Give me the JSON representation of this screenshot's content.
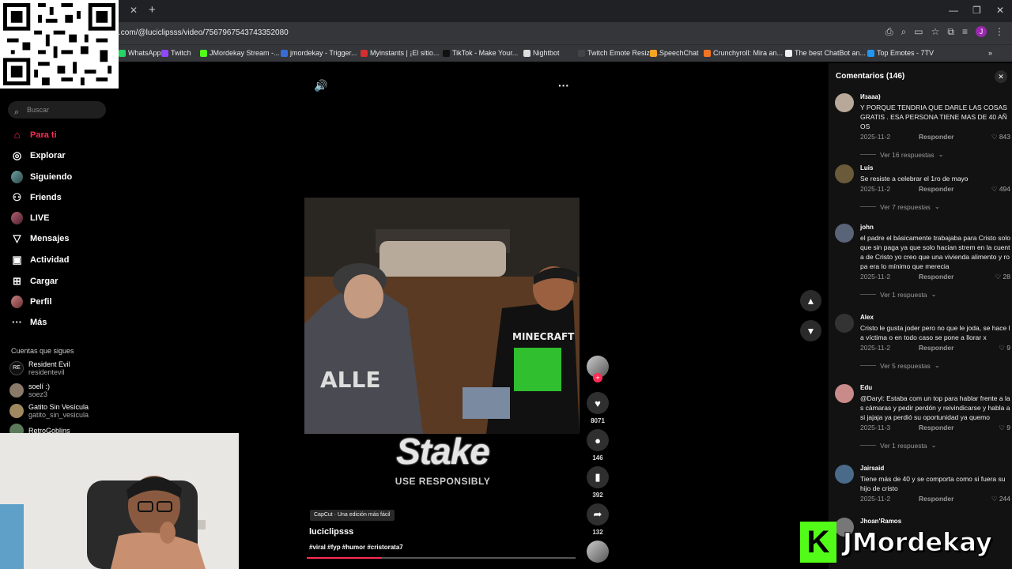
{
  "browser": {
    "url": ".com/@luciclipsss/video/7567967543743352080",
    "tab_close": "✕",
    "tab_new": "+",
    "bookmarks": [
      {
        "label": "WhatsApp",
        "color": "#25d366"
      },
      {
        "label": "Twitch",
        "color": "#9146ff"
      },
      {
        "label": "JMordekay Stream -...",
        "color": "#53fc18"
      },
      {
        "label": "jmordekay - Trigger...",
        "color": "#3b6bd6"
      },
      {
        "label": "Myinstants | ¡El sitio...",
        "color": "#d32f2f"
      },
      {
        "label": "TikTok - Make Your...",
        "color": "#111111"
      },
      {
        "label": "Nightbot",
        "color": "#dddddd"
      },
      {
        "label": "Twitch Emote Resize...",
        "color": "#444444"
      },
      {
        "label": "SpeechChat",
        "color": "#f5a623"
      },
      {
        "label": "Crunchyroll: Mira an...",
        "color": "#f47521"
      },
      {
        "label": "The best ChatBot an...",
        "color": "#eeeeee"
      },
      {
        "label": "Top Emotes - 7TV",
        "color": "#2196f3"
      }
    ]
  },
  "sidebar": {
    "search_placeholder": "Buscar",
    "nav": [
      {
        "label": "Para ti",
        "icon": "home-icon",
        "active": true
      },
      {
        "label": "Explorar",
        "icon": "compass-icon"
      },
      {
        "label": "Siguiendo",
        "icon": "following-avatar"
      },
      {
        "label": "Friends",
        "icon": "friends-icon"
      },
      {
        "label": "LIVE",
        "icon": "live-avatar"
      },
      {
        "label": "Mensajes",
        "icon": "messages-icon"
      },
      {
        "label": "Actividad",
        "icon": "activity-icon"
      },
      {
        "label": "Cargar",
        "icon": "upload-icon"
      },
      {
        "label": "Perfil",
        "icon": "profile-avatar"
      },
      {
        "label": "Más",
        "icon": "more-icon"
      }
    ],
    "following_title": "Cuentas que sigues",
    "accounts": [
      {
        "name": "Resident Evil",
        "handle": "residentevil"
      },
      {
        "name": "soelí :)",
        "handle": "soez3"
      },
      {
        "name": "Gatito Sin Vesícula",
        "handle": "gatito_sin_vesicula"
      },
      {
        "name": "RetroGoblins",
        "handle": ""
      }
    ]
  },
  "video": {
    "sponsor_logo": "Stake",
    "sponsor_sub": "USE RESPONSIBLY",
    "capcut_label": "CapCut · Una edición más fácil",
    "author": "luciclipsss",
    "tags": "#viral #fyp #humor #cristorata7",
    "progress": 0.28
  },
  "actions": {
    "likes": "8071",
    "comments": "146",
    "saves": "392",
    "shares": "132"
  },
  "comments_panel": {
    "title": "Comentarios (146)",
    "reply_label": "Responder",
    "items": [
      {
        "user": "Изааа)",
        "text": "Y PORQUE TENDRIA QUE DARLE LAS COSAS GRATIS . ESA PERSONA TIENE MAS DE 40 AÑOS",
        "date": "2025-11-2",
        "likes": "843",
        "more": "Ver 16 respuestas",
        "color": "#b8a89a"
      },
      {
        "user": "Luis",
        "text": "Se resiste a celebrar el 1ro de mayo",
        "date": "2025-11-2",
        "likes": "494",
        "more": "Ver 7 respuestas",
        "color": "#6b5a3a"
      },
      {
        "user": "john",
        "text": "el padre el básicamente trabajaba para Cristo solo que sin paga ya que solo hacian strem en la cuenta de Cristo yo creo que una vivienda alimento y ropa era lo mínimo que merecia",
        "date": "2025-11-2",
        "likes": "28",
        "more": "Ver 1 respuesta",
        "color": "#5a6478"
      },
      {
        "user": "Alex",
        "text": "Cristo le gusta joder pero no que le joda, se hace la víctima o en todo caso se pone a llorar x",
        "date": "2025-11-2",
        "likes": "9",
        "more": "Ver 5 respuestas",
        "color": "#333333"
      },
      {
        "user": "Edu",
        "text": "@Daryl: Estaba com un top para hablar frente a las cámaras y pedir perdón y reivindicarse y habla asi jajaja ya perdió su oportunidad ya quemo",
        "date": "2025-11-3",
        "likes": "9",
        "more": "Ver 1 respuesta",
        "color": "#c98a8a"
      },
      {
        "user": "Jairsaid",
        "text": "Tiene más de 40 y se comporta como si fuera su hijo de cristo",
        "date": "2025-11-2",
        "likes": "244",
        "more": "",
        "color": "#4a6a8a"
      },
      {
        "user": "Jhoan'Ramos",
        "text": "",
        "date": "",
        "likes": "",
        "more": "",
        "color": "#777777"
      }
    ]
  },
  "overlay": {
    "streamer_name": "JMordekay",
    "kick_letter": "K",
    "kick_color": "#53fc18"
  }
}
